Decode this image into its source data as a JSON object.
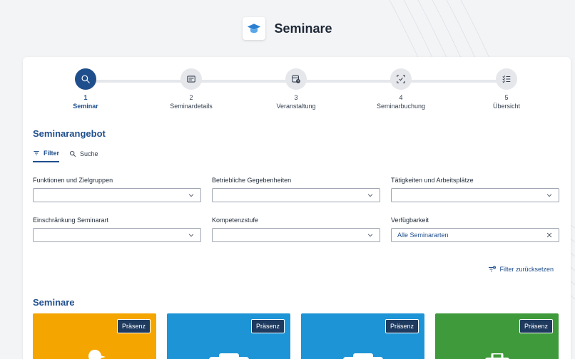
{
  "app": {
    "title": "Seminare",
    "icon": "graduation-cap-icon"
  },
  "stepper": {
    "steps": [
      {
        "num": "1",
        "label": "Seminar",
        "icon": "search-icon",
        "active": true
      },
      {
        "num": "2",
        "label": "Seminardetails",
        "icon": "details-icon",
        "active": false
      },
      {
        "num": "3",
        "label": "Veranstaltung",
        "icon": "calendar-clock-icon",
        "active": false
      },
      {
        "num": "4",
        "label": "Seminarbuchung",
        "icon": "booking-icon",
        "active": false
      },
      {
        "num": "5",
        "label": "Übersicht",
        "icon": "checklist-icon",
        "active": false
      }
    ]
  },
  "section": {
    "title": "Seminarangebot",
    "tabs": [
      {
        "label": "Filter",
        "icon": "filter-icon",
        "active": true
      },
      {
        "label": "Suche",
        "icon": "search-icon",
        "active": false
      }
    ]
  },
  "filters": [
    {
      "label": "Funktionen und Zielgruppen",
      "value": ""
    },
    {
      "label": "Betriebliche Gegebenheiten",
      "value": ""
    },
    {
      "label": "Tätigkeiten und Arbeitsplätze",
      "value": ""
    },
    {
      "label": "Einschränkung Seminarart",
      "value": ""
    },
    {
      "label": "Kompetenzstufe",
      "value": ""
    },
    {
      "label": "Verfügbarkeit",
      "value": "Alle Seminararten"
    }
  ],
  "reset_label": "Filter zurücksetzen",
  "seminars": {
    "title": "Seminare",
    "tiles": [
      {
        "badge": "Präsenz",
        "color": "#f5a500",
        "icon": "duck-icon"
      },
      {
        "badge": "Präsenz",
        "color": "#1d94d6",
        "icon": "camera-icon"
      },
      {
        "badge": "Präsenz",
        "color": "#1d94d6",
        "icon": "camera-icon"
      },
      {
        "badge": "Präsenz",
        "color": "#3e9a3a",
        "icon": "briefcase-icon"
      }
    ]
  },
  "colors": {
    "primary": "#1f4e8c",
    "badge_bg": "#1f3a5f"
  }
}
